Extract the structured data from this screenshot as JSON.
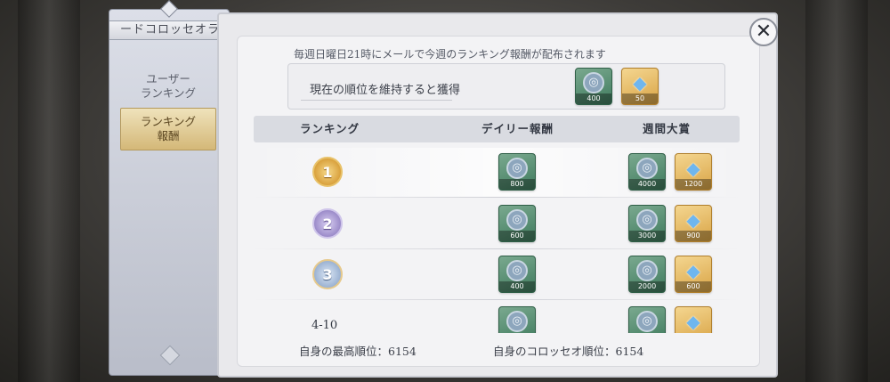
{
  "sidebar": {
    "header": "ードコロッセオラ",
    "items": [
      {
        "label": "ユーザー\nランキング",
        "active": false
      },
      {
        "label": "ランキング\n報酬",
        "active": true
      }
    ]
  },
  "notice": "毎週日曜日21時にメールで今週のランキング報酬が配布されます",
  "keep_rank": {
    "label": "現在の順位を維持すると獲得",
    "rewards": [
      {
        "icon": "silver-coin-icon",
        "qty": "400"
      },
      {
        "icon": "diamond-icon",
        "qty": "50"
      }
    ]
  },
  "table": {
    "headers": [
      "ランキング",
      "デイリー報酬",
      "週間大賞"
    ],
    "rows": [
      {
        "rank": "1",
        "rank_label": "",
        "daily": "800",
        "weekly_coin": "4000",
        "weekly_gem": "1200"
      },
      {
        "rank": "2",
        "rank_label": "",
        "daily": "600",
        "weekly_coin": "3000",
        "weekly_gem": "900"
      },
      {
        "rank": "3",
        "rank_label": "",
        "daily": "400",
        "weekly_coin": "2000",
        "weekly_gem": "600"
      },
      {
        "rank": "",
        "rank_label": "4-10",
        "daily": "",
        "weekly_coin": "",
        "weekly_gem": ""
      }
    ]
  },
  "footer": {
    "best_rank": "自身の最高順位：6154",
    "colosseum_rank": "自身のコロッセオ順位：6154"
  },
  "close_symbol": "✕",
  "icon_glyphs": {
    "coin": "◎",
    "gem": "◆"
  },
  "colors": {
    "active_tab": "#d4b878",
    "coin_bg": "#3f7a5d",
    "gem_bg": "#d9a446"
  }
}
